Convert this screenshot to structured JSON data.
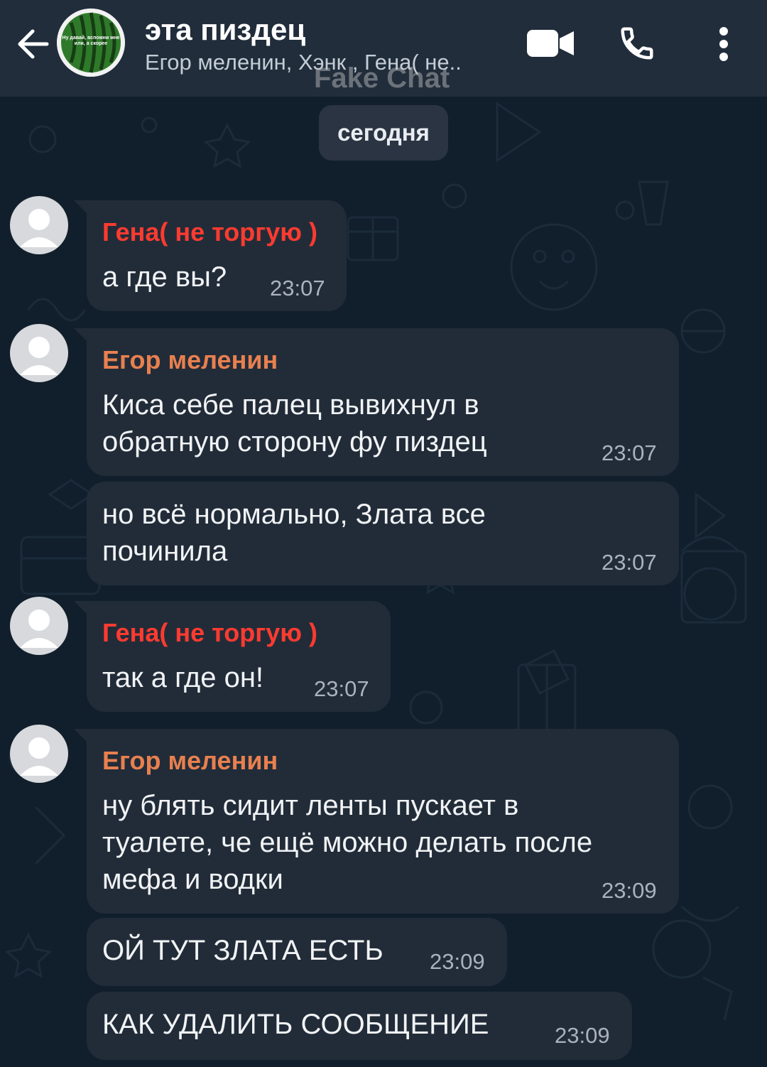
{
  "header": {
    "title": "эта пиздец",
    "subtitle": "Егор меленин, Хэнк , Гена( не..",
    "watermark": "Fake Chat",
    "avatar_caption": "Ну давай, вспомни мне или, а скорее",
    "icons": [
      "back-arrow-icon",
      "video-camera-icon",
      "phone-icon",
      "more-vert-icon"
    ]
  },
  "date_label": "сегодня",
  "colors": {
    "header_bg": "#212d3b",
    "chat_bg": "#111f2c",
    "bubble_bg": "#222c39",
    "sender_gena": "#ff3b30",
    "sender_egor": "#e8804f"
  },
  "messages": [
    {
      "sender": "Гена( не торгую )",
      "lines": [
        "а где вы?"
      ],
      "time": "23:07"
    },
    {
      "sender": "Егор меленин",
      "lines": [
        "Киса себе палец вывихнул в",
        "обратную сторону фу пиздец"
      ],
      "time": "23:07"
    },
    {
      "sender": "",
      "lines": [
        "но всё нормально, Злата все",
        "починила"
      ],
      "time": "23:07"
    },
    {
      "sender": "Гена( не торгую )",
      "lines": [
        "так а где он!"
      ],
      "time": "23:07"
    },
    {
      "sender": "Егор меленин",
      "lines": [
        "ну блять сидит ленты пускает в",
        "туалете, че ещё можно делать после",
        "мефа и водки"
      ],
      "time": "23:09"
    },
    {
      "sender": "",
      "lines": [
        "ОЙ ТУТ ЗЛАТА ЕСТЬ"
      ],
      "time": "23:09"
    },
    {
      "sender": "",
      "lines": [
        "КАК УДАЛИТЬ СООБЩЕНИЕ"
      ],
      "time": "23:09"
    }
  ]
}
